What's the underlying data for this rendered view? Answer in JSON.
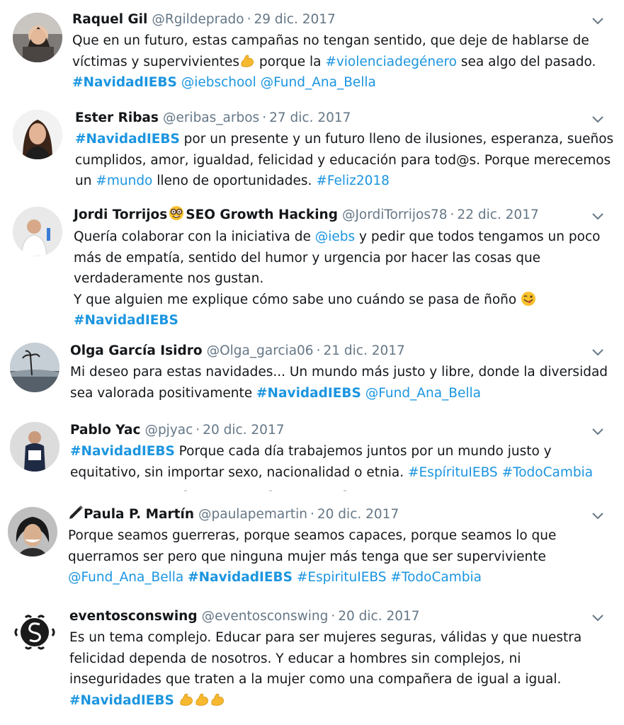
{
  "colors": {
    "link": "#1b95e0",
    "text": "#14171a",
    "muted": "#657786"
  },
  "tweets": [
    {
      "name": "Raquel Gil",
      "handle": "@Rgildeprado",
      "date": "29 dic. 2017",
      "lines": [
        [
          {
            "t": "Que en un futuro, estas campañas no tengan sentido, que deje de hablarse de"
          }
        ],
        [
          {
            "t": "víctimas y supervivientes"
          },
          {
            "e": "flexed-biceps-emoji"
          },
          {
            "t": " porque la "
          },
          {
            "t": "#violenciadegénero",
            "k": "link"
          },
          {
            "t": " sea algo del pasado."
          }
        ],
        [
          {
            "t": "#NavidadIEBS",
            "k": "tag"
          },
          {
            "t": " "
          },
          {
            "t": "@iebschool",
            "k": "link"
          },
          {
            "t": " "
          },
          {
            "t": "@Fund_Ana_Bella",
            "k": "link"
          }
        ]
      ]
    },
    {
      "name": "Ester Ribas",
      "handle": "@eribas_arbos",
      "date": "27 dic. 2017",
      "lines": [
        [
          {
            "t": "#NavidadIEBS",
            "k": "tag"
          },
          {
            "t": " por un presente y un futuro lleno de ilusiones, esperanza, sueños"
          }
        ],
        [
          {
            "t": "cumplidos, amor, igualdad, felicidad y educación para tod@s. Porque merecemos"
          }
        ],
        [
          {
            "t": "un "
          },
          {
            "t": "#mundo",
            "k": "link"
          },
          {
            "t": " lleno de oportunidades. "
          },
          {
            "t": "#Feliz2018",
            "k": "link"
          }
        ]
      ]
    },
    {
      "name": "Jordi Torrijos",
      "name_suffix": "SEO Growth Hacking",
      "handle": "@JordiTorrijos78",
      "date": "22 dic. 2017",
      "lines": [
        [
          {
            "t": "Quería colaborar con la iniciativa de "
          },
          {
            "t": "@iebs",
            "k": "link"
          },
          {
            "t": " y pedir que todos tengamos un poco"
          }
        ],
        [
          {
            "t": "más de empatía, sentido del humor y urgencia por hacer las cosas que"
          }
        ],
        [
          {
            "t": "verdaderamente nos gustan."
          }
        ],
        [
          {
            "t": "Y que alguien me explique cómo sabe uno cuándo se pasa de ñoño "
          },
          {
            "e": "winking-tongue-emoji"
          }
        ],
        [
          {
            "t": "#NavidadIEBS",
            "k": "tag"
          }
        ]
      ]
    },
    {
      "name": "Olga García Isidro",
      "handle": "@Olga_garcia06",
      "date": "21 dic. 2017",
      "lines": [
        [
          {
            "t": "Mi deseo para estas navidades... Un mundo más justo y libre, donde la diversidad"
          }
        ],
        [
          {
            "t": "sea valorada positivamente "
          },
          {
            "t": "#NavidadIEBS",
            "k": "tag"
          },
          {
            "t": " "
          },
          {
            "t": "@Fund_Ana_Bella",
            "k": "link"
          }
        ]
      ]
    },
    {
      "name": "Pablo Yac",
      "handle": "@pjyac",
      "date": "20 dic. 2017",
      "lines": [
        [
          {
            "t": "#NavidadIEBS",
            "k": "tag"
          },
          {
            "t": " Porque cada día trabajemos juntos por un mundo justo y"
          }
        ],
        [
          {
            "t": "equitativo, sin importar sexo, nacionalidad o etnia. "
          },
          {
            "t": "#EspírituIEBS",
            "k": "link"
          },
          {
            "t": " "
          },
          {
            "t": "#TodoCambia",
            "k": "link"
          }
        ]
      ]
    },
    {
      "name": "Paula P. Martín",
      "handle": "@paulapemartin",
      "date": "20 dic. 2017",
      "lines": [
        [
          {
            "t": "Porque seamos guerreras, porque seamos capaces, porque seamos lo que"
          }
        ],
        [
          {
            "t": "querramos ser pero que ninguna mujer más tenga que ser superviviente"
          }
        ],
        [
          {
            "t": "@Fund_Ana_Bella",
            "k": "link"
          },
          {
            "t": " "
          },
          {
            "t": "#NavidadIEBS",
            "k": "tag"
          },
          {
            "t": " "
          },
          {
            "t": "#EspirituIEBS",
            "k": "link"
          },
          {
            "t": " "
          },
          {
            "t": "#TodoCambia",
            "k": "link"
          }
        ]
      ]
    },
    {
      "name": "eventosconswing",
      "handle": "@eventosconswing",
      "date": "20 dic. 2017",
      "lines": [
        [
          {
            "t": "Es un tema complejo. Educar para ser mujeres seguras, válidas y que nuestra"
          }
        ],
        [
          {
            "t": "felicidad dependa de nosotros. Y educar a hombres sin complejos, ni"
          }
        ],
        [
          {
            "t": "inseguridades que traten a la mujer como una compañera de igual a igual."
          }
        ],
        [
          {
            "t": "#NavidadIEBS",
            "k": "tag"
          },
          {
            "t": " "
          },
          {
            "e": "flexed-biceps-emoji"
          },
          {
            "e": "flexed-biceps-emoji"
          },
          {
            "e": "flexed-biceps-emoji"
          }
        ]
      ]
    }
  ]
}
